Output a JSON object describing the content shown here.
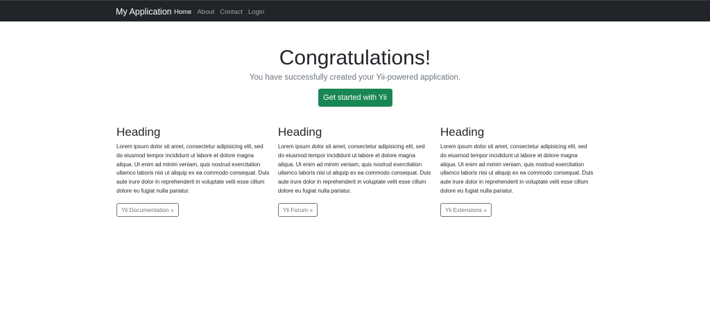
{
  "navbar": {
    "brand": "My Application",
    "items": [
      {
        "label": "Home",
        "active": true
      },
      {
        "label": "About",
        "active": false
      },
      {
        "label": "Contact",
        "active": false
      },
      {
        "label": "Login",
        "active": false
      }
    ]
  },
  "jumbotron": {
    "title": "Congratulations!",
    "lead": "You have successfully created your Yii-powered application.",
    "button_label": "Get started with Yii"
  },
  "columns": [
    {
      "heading": "Heading",
      "text": "Lorem ipsum dolor sit amet, consectetur adipisicing elit, sed do eiusmod tempor incididunt ut labore et dolore magna aliqua. Ut enim ad minim veniam, quis nostrud exercitation ullamco laboris nisi ut aliquip ex ea commodo consequat. Duis aute irure dolor in reprehenderit in voluptate velit esse cillum dolore eu fugiat nulla pariatur.",
      "button_label": "Yii Documentation »"
    },
    {
      "heading": "Heading",
      "text": "Lorem ipsum dolor sit amet, consectetur adipisicing elit, sed do eiusmod tempor incididunt ut labore et dolore magna aliqua. Ut enim ad minim veniam, quis nostrud exercitation ullamco laboris nisi ut aliquip ex ea commodo consequat. Duis aute irure dolor in reprehenderit in voluptate velit esse cillum dolore eu fugiat nulla pariatur.",
      "button_label": "Yii Forum »"
    },
    {
      "heading": "Heading",
      "text": "Lorem ipsum dolor sit amet, consectetur adipisicing elit, sed do eiusmod tempor incididunt ut labore et dolore magna aliqua. Ut enim ad minim veniam, quis nostrud exercitation ullamco laboris nisi ut aliquip ex ea commodo consequat. Duis aute irure dolor in reprehenderit in voluptate velit esse cillum dolore eu fugiat nulla pariatur.",
      "button_label": "Yii Extensions »"
    }
  ],
  "colors": {
    "navbar_bg": "#212529",
    "success": "#198754",
    "muted": "#6c757d"
  }
}
